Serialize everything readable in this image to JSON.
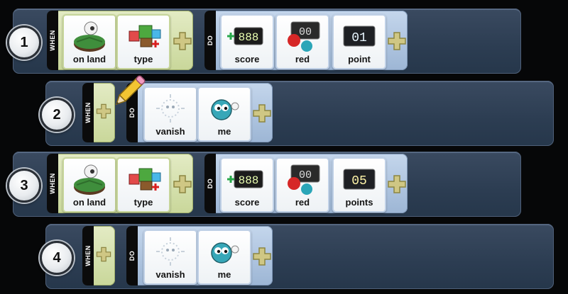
{
  "rules": [
    {
      "number": "1",
      "when_label": "WHEN",
      "do_label": "DO",
      "when_tiles": [
        {
          "label": "on land",
          "icon": "on-land-icon"
        },
        {
          "label": "type",
          "icon": "type-icon"
        }
      ],
      "do_tiles": [
        {
          "label": "score",
          "icon": "score-icon"
        },
        {
          "label": "red",
          "icon": "red-score-icon",
          "display": "00"
        },
        {
          "label": "point",
          "icon": "point-counter-icon",
          "display": "01"
        }
      ]
    },
    {
      "number": "2",
      "when_label": "WHEN",
      "do_label": "DO",
      "when_tiles": [],
      "do_tiles": [
        {
          "label": "vanish",
          "icon": "vanish-icon"
        },
        {
          "label": "me",
          "icon": "me-icon"
        }
      ]
    },
    {
      "number": "3",
      "when_label": "WHEN",
      "do_label": "DO",
      "when_tiles": [
        {
          "label": "on land",
          "icon": "on-land-icon"
        },
        {
          "label": "type",
          "icon": "type-icon"
        }
      ],
      "do_tiles": [
        {
          "label": "score",
          "icon": "score-icon"
        },
        {
          "label": "red",
          "icon": "red-score-icon",
          "display": "00"
        },
        {
          "label": "points",
          "icon": "points-counter-icon",
          "display": "05"
        }
      ]
    },
    {
      "number": "4",
      "when_label": "WHEN",
      "do_label": "DO",
      "when_tiles": [],
      "do_tiles": [
        {
          "label": "vanish",
          "icon": "vanish-icon"
        },
        {
          "label": "me",
          "icon": "me-icon"
        }
      ]
    }
  ],
  "colors": {
    "row_bg": "#2c3d52",
    "when_panel": "#d6e2ad",
    "do_panel": "#b3c8e2",
    "plus": "#c9c27a"
  }
}
